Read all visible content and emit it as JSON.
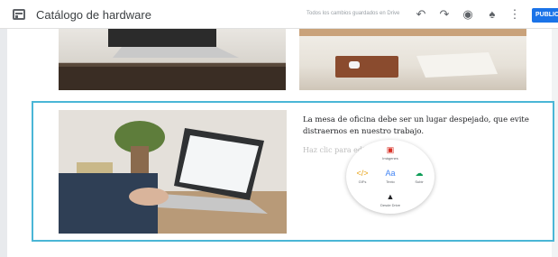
{
  "app": {
    "title": "Catálogo de hardware"
  },
  "toolbar": {
    "status": "Todos los cambios guardados en Drive",
    "publish_label": "PUBLIC",
    "icons": [
      "undo-icon",
      "redo-icon",
      "preview-icon",
      "add-user-icon",
      "more-icon"
    ]
  },
  "content": {
    "paragraph": "La mesa de oficina debe ser un lugar despejado, que evite distraernos en nuestro trabajo.",
    "hint": "Haz clic para editar"
  },
  "insert_menu": {
    "images": "Imágenes",
    "gifs": "GIFs",
    "text": "Texto",
    "upload": "Subir",
    "drive": "Desde Drive"
  },
  "colors": {
    "accent": "#1a73e8",
    "selection": "#4ab6d6"
  }
}
